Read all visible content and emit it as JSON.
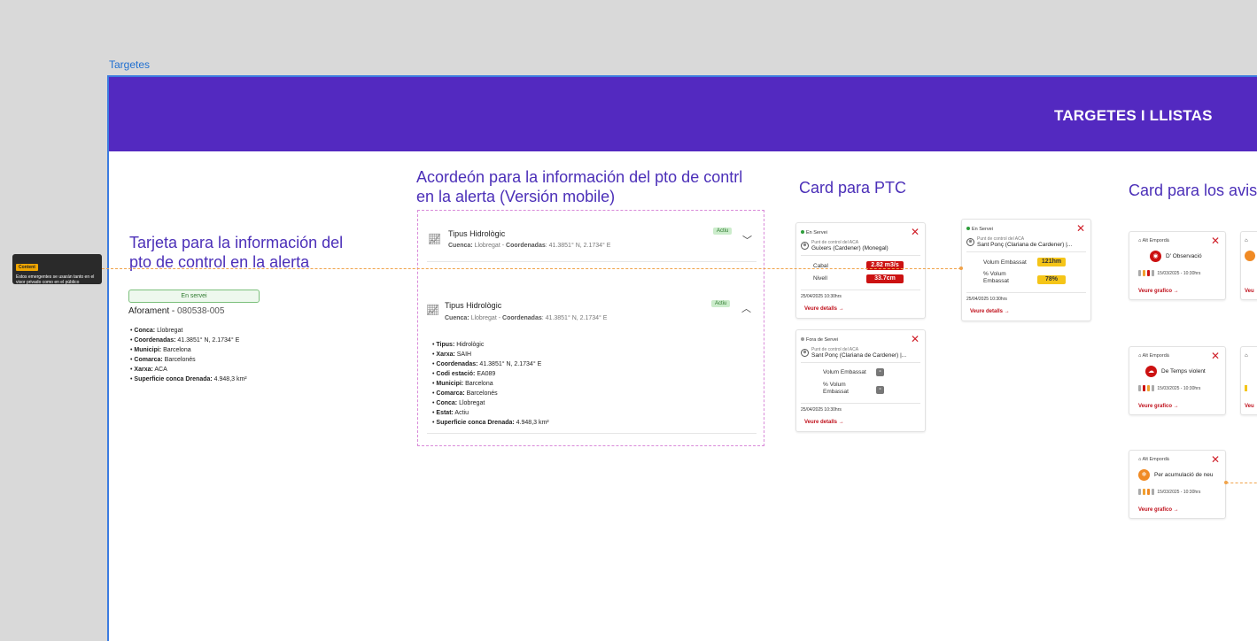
{
  "frame_label": "Targetes",
  "banner_title": "TARGETES I LLISTAS",
  "comment": {
    "tag": "Content",
    "text": "Estos emergentes se usarán tanto en el visor privado como en el público"
  },
  "section1": {
    "title": "Tarjeta para la información del pto de control en la alerta",
    "status": "En servei",
    "aforament_label": "Aforament",
    "aforament_code": "080538-005",
    "items": [
      {
        "k": "Conca:",
        "v": "Llobregat"
      },
      {
        "k": "Coordenadas:",
        "v": "41.3851° N, 2.1734° E"
      },
      {
        "k": "Municipi:",
        "v": "Barcelona"
      },
      {
        "k": "Comarca:",
        "v": "Barcelonés"
      },
      {
        "k": "Xarxa:",
        "v": "ACA"
      },
      {
        "k": "Superficie conca Drenada:",
        "v": "4.948,3 km²"
      }
    ]
  },
  "section2": {
    "title": "Acordeón para la información del pto de contrl en la alerta (Versión mobile)",
    "collapsed": {
      "title": "Tipus Hidrològic",
      "badge": "Actiu",
      "conca_label": "Cuenca:",
      "conca": "Llobregat",
      "coord_label": "Coordenadas",
      "coord": "41.3851° N, 2.1734° E"
    },
    "expanded": {
      "title": "Tipus Hidrològic",
      "badge": "Actiu",
      "conca_label": "Cuenca:",
      "conca": "Llobregat",
      "coord_label": "Coordenadas",
      "coord": "41.3851° N, 2.1734° E",
      "items": [
        {
          "k": "Tipus:",
          "v": "Hidrològic"
        },
        {
          "k": "Xarxa:",
          "v": "SAIH"
        },
        {
          "k": "Coordenadas:",
          "v": "41.3851° N, 2.1734° E"
        },
        {
          "k": "Codi estació:",
          "v": "EA089"
        },
        {
          "k": "Municipi:",
          "v": "Barcelona"
        },
        {
          "k": "Comarca:",
          "v": "Barcelonés"
        },
        {
          "k": "Conca:",
          "v": "Llobregat"
        },
        {
          "k": "Estat:",
          "v": "Actiu"
        },
        {
          "k": "Superficie conca Drenada:",
          "v": "4.948,3 km²"
        }
      ]
    }
  },
  "section3": {
    "title": "Card para PTC",
    "card1": {
      "status": "En Servei",
      "small": "Punt de control del ACA",
      "name": "Guixers (Cardener) (Monegal)",
      "r1_label": "Cabal",
      "r1_value": "2.82 m3/s",
      "r2_label": "Nivell",
      "r2_value": "33.7cm",
      "date": "25/04/2025 10:30hrs",
      "link": "Veure detalls"
    },
    "card2": {
      "status": "En Servei",
      "small": "Punt de control del ACA",
      "name": "Sant Ponç (Clariana de Cardener) |...",
      "r1_label": "Volum Embassat",
      "r1_value": "121hm",
      "r2_label": "% Volum Embassat",
      "r2_value": "78%",
      "date": "25/04/2025 10:30hrs",
      "link": "Veure detalls"
    },
    "card3": {
      "status": "Fora de Servei",
      "small": "Punt de control del ACA",
      "name": "Sant Ponç (Clariana de Cardener) |...",
      "r1_label": "Volum Embassat",
      "r1_value": "-",
      "r2_label": "% Volum Embassat",
      "r2_value": "-",
      "date": "25/04/2025 10:30hrs",
      "link": "Veure detalls"
    }
  },
  "section4": {
    "title": "Card para los avis",
    "cards": [
      {
        "loc": "Alt Empordà",
        "type": "D' Observació",
        "date": "15/03/2025 - 10:30hrs",
        "link": "Veure grafico"
      },
      {
        "loc": "Alt Empordà",
        "type": "De Temps violent",
        "date": "15/03/2025 - 10:30hrs",
        "link": "Veure grafico"
      },
      {
        "loc": "Alt Empordà",
        "type": "Per acumulació de neu",
        "date": "15/03/2025 - 10:30hrs",
        "link": "Veure grafico"
      }
    ],
    "peek_link": "Veu"
  },
  "colors": {
    "banner": "#5329c0",
    "accent_title": "#4b2fb8",
    "alert_red": "#cc1111",
    "warning_yellow": "#f5c518",
    "link_red": "#c0111c"
  }
}
